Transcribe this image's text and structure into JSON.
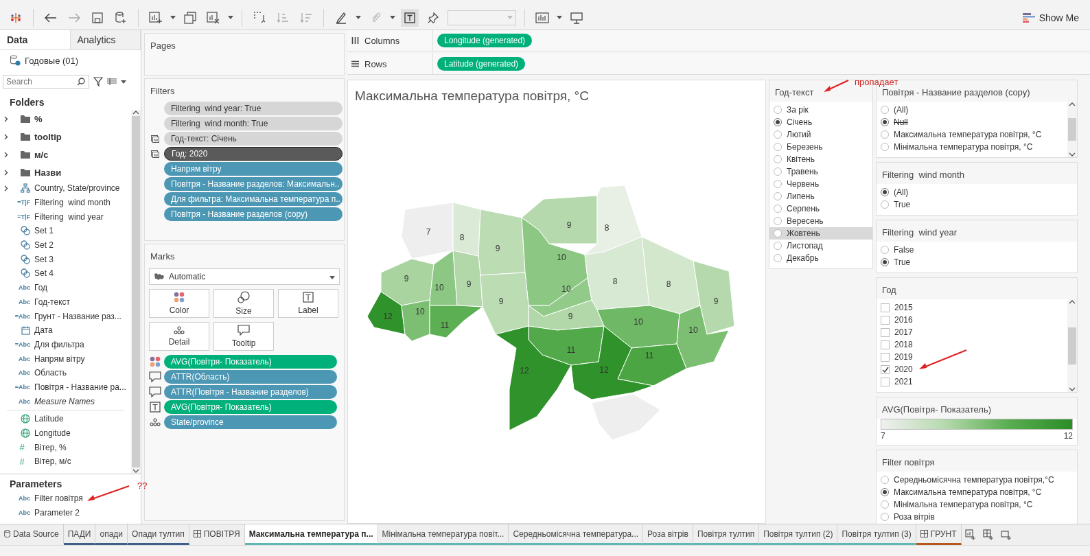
{
  "toolbar": {
    "show_me": "Show Me"
  },
  "data_pane": {
    "tabs": [
      {
        "label": "Data",
        "selected": true
      },
      {
        "label": "Analytics",
        "selected": false
      }
    ],
    "datasource": "Годовые (01)",
    "search": {
      "placeholder": "Search"
    },
    "folders_heading": "Folders",
    "fields": [
      {
        "kind": "folder",
        "name": "%"
      },
      {
        "kind": "folder",
        "name": "tooltip"
      },
      {
        "kind": "folder",
        "name": "м/с"
      },
      {
        "kind": "folder",
        "name": "Назви"
      },
      {
        "kind": "hierarchy",
        "name": "Country, State/province"
      },
      {
        "kind": "text",
        "glyph": "=T|F",
        "name": "Filtering  wind month"
      },
      {
        "kind": "text",
        "glyph": "=T|F",
        "name": "Filtering  wind year"
      },
      {
        "kind": "set",
        "name": "Set 1"
      },
      {
        "kind": "set",
        "name": "Set 2"
      },
      {
        "kind": "set",
        "name": "Set 3"
      },
      {
        "kind": "set",
        "name": "Set 4"
      },
      {
        "kind": "text",
        "glyph": "Abc",
        "name": "Год"
      },
      {
        "kind": "text",
        "glyph": "Abc",
        "name": "Год-текст"
      },
      {
        "kind": "text",
        "glyph": "=Abc",
        "name": "Грунт - Название раз..."
      },
      {
        "kind": "date",
        "name": "Дата"
      },
      {
        "kind": "text",
        "glyph": "=Abc",
        "name": "Для фильтра"
      },
      {
        "kind": "text",
        "glyph": "Abc",
        "name": "Напрям вітру"
      },
      {
        "kind": "text",
        "glyph": "Abc",
        "name": "Область"
      },
      {
        "kind": "text",
        "glyph": "=Abc",
        "name": "Повітря - Название ра..."
      },
      {
        "kind": "text",
        "glyph": "Abc",
        "name": "Measure Names",
        "italic": true
      },
      {
        "kind": "geo",
        "name": "Latitude"
      },
      {
        "kind": "geo",
        "name": "Longitude"
      },
      {
        "kind": "number",
        "glyph": "#",
        "name": "Вітер, %"
      },
      {
        "kind": "number",
        "glyph": "#",
        "name": "Вітер, м/с"
      }
    ],
    "parameters_heading": "Parameters",
    "parameters": [
      {
        "glyph": "Abc",
        "name": "Filter повітря"
      },
      {
        "glyph": "Abc",
        "name": "Parameter 2"
      }
    ]
  },
  "pages": {
    "title": "Pages"
  },
  "filters": {
    "title": "Filters",
    "pills": [
      {
        "text": "Filtering  wind year: True",
        "kind": "context",
        "shown": false
      },
      {
        "text": "Filtering  wind month: True",
        "kind": "context",
        "shown": false
      },
      {
        "text": "Год-текст: Січень",
        "kind": "context",
        "shown": true
      },
      {
        "text": "Год: 2020",
        "kind": "dark",
        "shown": true
      },
      {
        "text": "Напрям вітру",
        "kind": "dimension",
        "shown": false
      },
      {
        "text": "Повітря - Название разделов: Максимальн..",
        "kind": "dimension",
        "shown": false
      },
      {
        "text": "Для фильтра: Максимальна температура п..",
        "kind": "dimension",
        "shown": false
      },
      {
        "text": "Повітря - Название разделов (copy)",
        "kind": "dimension",
        "shown": false
      }
    ]
  },
  "marks": {
    "title": "Marks",
    "mark_type": "Automatic",
    "buttons": [
      {
        "kind": "color",
        "label": "Color"
      },
      {
        "kind": "size",
        "label": "Size"
      },
      {
        "kind": "label",
        "label": "Label"
      },
      {
        "kind": "detail",
        "label": "Detail"
      },
      {
        "kind": "tooltip",
        "label": "Tooltip"
      }
    ],
    "pills": [
      {
        "kind": "color-measure",
        "text": "AVG(Повітря- Показатель)"
      },
      {
        "kind": "tooltip-dimension",
        "text": "ATTR(Область)"
      },
      {
        "kind": "tooltip-dimension",
        "text": "ATTR(Повітря - Название разделов)"
      },
      {
        "kind": "label-measure",
        "text": "AVG(Повітря- Показатель)"
      },
      {
        "kind": "detail-dimension",
        "text": "State/province"
      }
    ]
  },
  "columns_shelf": {
    "label": "Columns",
    "pill": "Longitude (generated)"
  },
  "rows_shelf": {
    "label": "Rows",
    "pill": "Latitude (generated)"
  },
  "view": {
    "title": "Максимальна температура повітря, °C",
    "regions": [
      {
        "label": "7",
        "color": "#eeeeee"
      },
      {
        "label": "8",
        "color": "#dbeAd6"
      },
      {
        "label": "9",
        "color": "#bcdcb4"
      },
      {
        "label": "9",
        "color": "#b5d9ad"
      },
      {
        "label": "8",
        "color": "#e8efe5"
      },
      {
        "label": "10",
        "color": "#8cc884"
      },
      {
        "label": "9",
        "color": "#a9d49f"
      },
      {
        "label": "10",
        "color": "#8cc884"
      },
      {
        "label": "9",
        "color": "#b2d8aa"
      },
      {
        "label": "10",
        "color": "#91ca89"
      },
      {
        "label": "8",
        "color": "#d7e9d2"
      },
      {
        "label": "8",
        "color": "#d2e7cc"
      },
      {
        "label": "9",
        "color": "#b5d9ad"
      },
      {
        "label": "9",
        "color": "#bcdcb4"
      },
      {
        "label": "12",
        "color": "#2f922b"
      },
      {
        "label": "10",
        "color": "#7cbf73"
      },
      {
        "label": "11",
        "color": "#5caf53"
      },
      {
        "label": "9",
        "color": "#b2d8aa"
      },
      {
        "label": "10",
        "color": "#6fb866"
      },
      {
        "label": "10",
        "color": "#7cbf73"
      },
      {
        "label": "11",
        "color": "#52a949"
      },
      {
        "label": "12",
        "color": "#2f922b"
      },
      {
        "label": "11",
        "color": "#4ca543"
      },
      {
        "label": "12",
        "color": "#2f922b"
      },
      {
        "color": "#eeeeee"
      }
    ]
  },
  "left_filter": {
    "title": "Год-текст",
    "options": [
      {
        "label": "За рік",
        "selected": false,
        "highlighted": false
      },
      {
        "label": "Січень",
        "selected": true,
        "highlighted": false
      },
      {
        "label": "Лютий",
        "selected": false,
        "highlighted": false
      },
      {
        "label": "Березень",
        "selected": false,
        "highlighted": false
      },
      {
        "label": "Квітень",
        "selected": false,
        "highlighted": false
      },
      {
        "label": "Травень",
        "selected": false,
        "highlighted": false
      },
      {
        "label": "Червень",
        "selected": false,
        "highlighted": false
      },
      {
        "label": "Липень",
        "selected": false,
        "highlighted": false
      },
      {
        "label": "Серпень",
        "selected": false,
        "highlighted": false
      },
      {
        "label": "Вересень",
        "selected": false,
        "highlighted": false
      },
      {
        "label": "Жовтень",
        "selected": false,
        "highlighted": true
      },
      {
        "label": "Листопад",
        "selected": false,
        "highlighted": false
      },
      {
        "label": "Декабрь",
        "selected": false,
        "highlighted": false
      }
    ]
  },
  "right_cards": [
    {
      "kind": "radio",
      "title": "Повітря - Название разделов (copy)",
      "scroll": true,
      "options": [
        {
          "label": "(All)",
          "selected": false,
          "struck": false
        },
        {
          "label": "Null",
          "selected": true,
          "struck": true
        },
        {
          "label": "Максимальна температура повітря, °C",
          "selected": false,
          "struck": false
        },
        {
          "label": "Мінімальна температура повітря, °C",
          "selected": false,
          "struck": false
        }
      ]
    },
    {
      "kind": "radio",
      "title": "Filtering  wind month",
      "scroll": false,
      "options": [
        {
          "label": "(All)",
          "selected": true
        },
        {
          "label": "True",
          "selected": false
        }
      ]
    },
    {
      "kind": "radio",
      "title": "Filtering  wind year",
      "scroll": false,
      "options": [
        {
          "label": "False",
          "selected": false
        },
        {
          "label": "True",
          "selected": true
        }
      ]
    },
    {
      "kind": "checkbox",
      "title": "Год",
      "scroll": true,
      "options": [
        {
          "label": "2015",
          "checked": false
        },
        {
          "label": "2016",
          "checked": false
        },
        {
          "label": "2017",
          "checked": false
        },
        {
          "label": "2018",
          "checked": false
        },
        {
          "label": "2019",
          "checked": false
        },
        {
          "label": "2020",
          "checked": true
        },
        {
          "label": "2021",
          "checked": false
        }
      ]
    },
    {
      "kind": "legend",
      "title": "AVG(Повітря- Показатель)",
      "min": "7",
      "max": "12"
    },
    {
      "kind": "radio",
      "title": "Filter повітря",
      "scroll": false,
      "options": [
        {
          "label": "Середньомісячна температура повітря,°С",
          "selected": false
        },
        {
          "label": "Максимальна температура повітря, °С",
          "selected": true
        },
        {
          "label": "Мінімальна температура повітря, °С",
          "selected": false
        },
        {
          "label": "Роза вітрів",
          "selected": false
        }
      ]
    }
  ],
  "sheet_tabs": [
    {
      "kind": "datasource",
      "label": "Data Source",
      "selected": false
    },
    {
      "kind": "sheet",
      "label": "ПАДИ",
      "selected": false,
      "color": "#3e5f8a"
    },
    {
      "kind": "sheet",
      "label": "опади",
      "selected": false,
      "color": "#3e5f8a"
    },
    {
      "kind": "sheet",
      "label": "Опади тултип",
      "selected": false,
      "color": "#3e5f8a"
    },
    {
      "kind": "dashboard",
      "label": "ПОВІТРЯ",
      "selected": false
    },
    {
      "kind": "sheet",
      "label": "Максимальна температура п...",
      "selected": true,
      "color": "#5fb8b4"
    },
    {
      "kind": "sheet",
      "label": "Мінімальна температура повіт...",
      "selected": false,
      "color": "#5fb8b4"
    },
    {
      "kind": "sheet",
      "label": "Середньомісячна температура...",
      "selected": false,
      "color": "#5fb8b4"
    },
    {
      "kind": "sheet",
      "label": "Роза вітрів",
      "selected": false,
      "color": "#5fb8b4"
    },
    {
      "kind": "sheet",
      "label": "Повітря тултип",
      "selected": false,
      "color": "#5fb8b4"
    },
    {
      "kind": "sheet",
      "label": "Повітря тултип (2)",
      "selected": false,
      "color": "#5fb8b4"
    },
    {
      "kind": "sheet",
      "label": "Повітря тултип (3)",
      "selected": false,
      "color": "#5fb8b4"
    },
    {
      "kind": "dashboard",
      "label": "ГРУНТ",
      "selected": false,
      "color": "#b5581c"
    }
  ],
  "annotations": [
    {
      "kind": "marks",
      "text": "??"
    },
    {
      "kind": "note",
      "text": "пропадает"
    },
    {
      "kind": "arrow"
    }
  ]
}
